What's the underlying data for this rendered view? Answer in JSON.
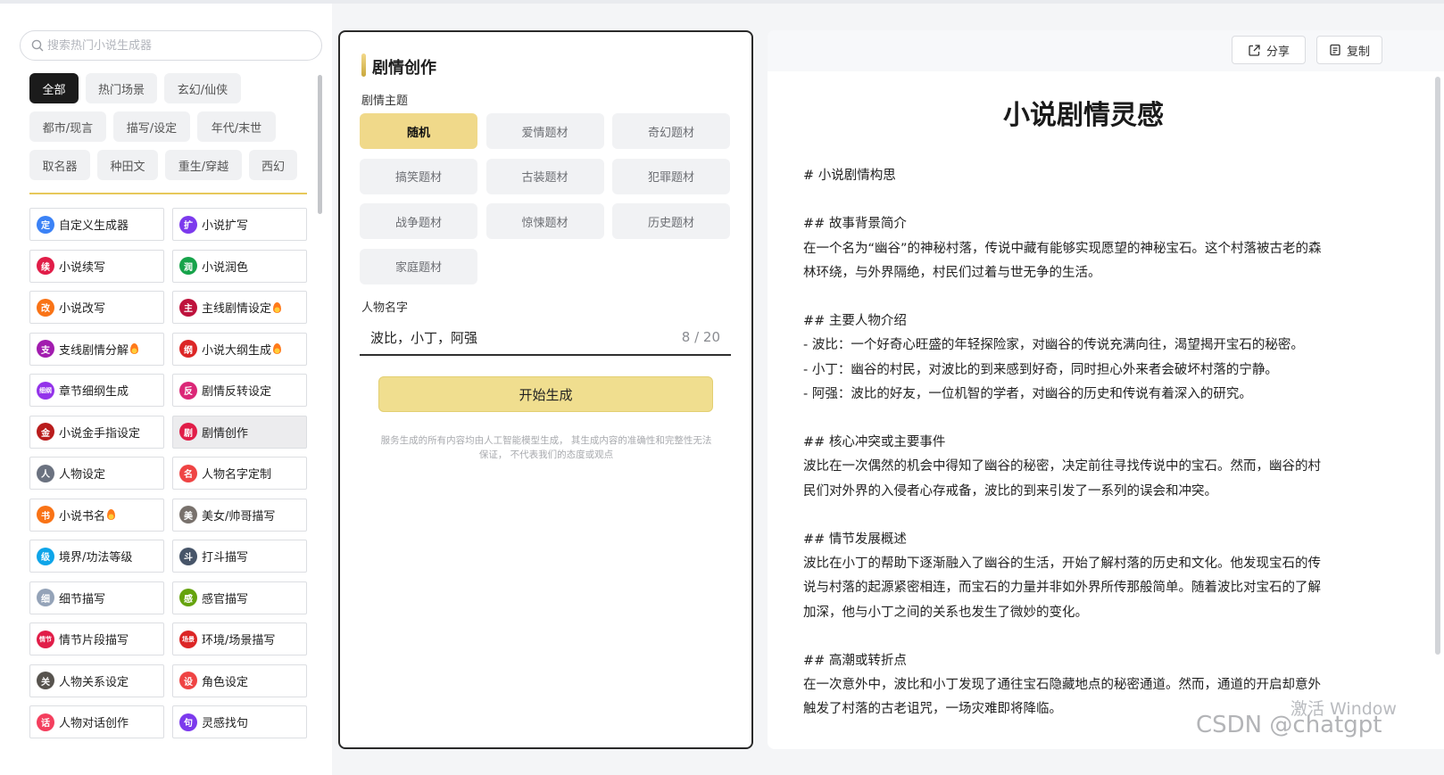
{
  "search": {
    "placeholder": "搜索热门小说生成器"
  },
  "categories": [
    {
      "label": "全部",
      "active": true
    },
    {
      "label": "热门场景"
    },
    {
      "label": "玄幻/仙侠"
    },
    {
      "label": "都市/现言"
    },
    {
      "label": "描写/设定"
    },
    {
      "label": "年代/末世"
    },
    {
      "label": "取名器"
    },
    {
      "label": "种田文"
    },
    {
      "label": "重生/穿越"
    },
    {
      "label": "西幻"
    }
  ],
  "tools": [
    {
      "label": "自定义生成器",
      "icon": "custom-icon",
      "glyph": "定",
      "color": "#3b82f6"
    },
    {
      "label": "小说扩写",
      "icon": "expand-icon",
      "glyph": "扩",
      "color": "#7c3aed"
    },
    {
      "label": "小说续写",
      "icon": "continue-icon",
      "glyph": "续",
      "color": "#e11d48"
    },
    {
      "label": "小说润色",
      "icon": "polish-icon",
      "glyph": "润",
      "color": "#16a34a"
    },
    {
      "label": "小说改写",
      "icon": "rewrite-icon",
      "glyph": "改",
      "color": "#f97316"
    },
    {
      "label": "主线剧情设定",
      "icon": "mainline-icon",
      "glyph": "主",
      "color": "#be123c",
      "hot": true
    },
    {
      "label": "支线剧情分解",
      "icon": "subplot-icon",
      "glyph": "支",
      "color": "#a21caf",
      "hot": true
    },
    {
      "label": "小说大纲生成",
      "icon": "outline-icon",
      "glyph": "纲",
      "color": "#dc2626",
      "hot": true
    },
    {
      "label": "章节细纲生成",
      "icon": "chapter-icon",
      "glyph": "细纲",
      "color": "#9333ea"
    },
    {
      "label": "剧情反转设定",
      "icon": "twist-icon",
      "glyph": "反",
      "color": "#db2777"
    },
    {
      "label": "小说金手指设定",
      "icon": "goldfinger-icon",
      "glyph": "金",
      "color": "#b91c1c"
    },
    {
      "label": "剧情创作",
      "icon": "plot-icon",
      "glyph": "剧",
      "color": "#e11d48",
      "selected": true
    },
    {
      "label": "人物设定",
      "icon": "character-avatar-icon",
      "glyph": "人",
      "color": "#6b7280"
    },
    {
      "label": "人物名字定制",
      "icon": "name-icon",
      "glyph": "名",
      "color": "#ef4444"
    },
    {
      "label": "小说书名",
      "icon": "book-title-icon",
      "glyph": "书",
      "color": "#f97316",
      "hot": true
    },
    {
      "label": "美女/帅哥描写",
      "icon": "portrait-icon",
      "glyph": "美",
      "color": "#78716c"
    },
    {
      "label": "境界/功法等级",
      "icon": "level-icon",
      "glyph": "级",
      "color": "#0ea5e9"
    },
    {
      "label": "打斗描写",
      "icon": "fight-icon",
      "glyph": "斗",
      "color": "#475569"
    },
    {
      "label": "细节描写",
      "icon": "magnifier-icon",
      "glyph": "细",
      "color": "#94a3b8"
    },
    {
      "label": "感官描写",
      "icon": "senses-icon",
      "glyph": "感",
      "color": "#65a30d"
    },
    {
      "label": "情节片段描写",
      "icon": "scene-fragment-icon",
      "glyph": "情节",
      "color": "#e11d48"
    },
    {
      "label": "环境/场景描写",
      "icon": "environment-icon",
      "glyph": "场景",
      "color": "#dc2626"
    },
    {
      "label": "人物关系设定",
      "icon": "relation-icon",
      "glyph": "关",
      "color": "#57534e"
    },
    {
      "label": "角色设定",
      "icon": "role-icon",
      "glyph": "设",
      "color": "#ef4444"
    },
    {
      "label": "人物对话创作",
      "icon": "dialogue-icon",
      "glyph": "话",
      "color": "#f43f5e"
    },
    {
      "label": "灵感找句",
      "icon": "inspiration-icon",
      "glyph": "句",
      "color": "#7c3aed"
    }
  ],
  "form": {
    "title": "剧情创作",
    "theme_label": "剧情主题",
    "themes": [
      {
        "label": "随机",
        "active": true
      },
      {
        "label": "爱情题材"
      },
      {
        "label": "奇幻题材"
      },
      {
        "label": "搞笑题材"
      },
      {
        "label": "古装题材"
      },
      {
        "label": "犯罪题材"
      },
      {
        "label": "战争题材"
      },
      {
        "label": "惊悚题材"
      },
      {
        "label": "历史题材"
      },
      {
        "label": "家庭题材"
      }
    ],
    "name_label": "人物名字",
    "name_value": "波比，小丁，阿强",
    "name_count": "8 / 20",
    "generate_label": "开始生成",
    "disclaimer_line1": "服务生成的所有内容均由人工智能模型生成， 其生成内容的准确性和完整性无法",
    "disclaimer_line2": "保证， 不代表我们的态度或观点"
  },
  "result": {
    "share_label": "分享",
    "copy_label": "复制",
    "title": "小说剧情灵感",
    "lines": [
      "# 小说剧情构思",
      "",
      "## 故事背景简介",
      "在一个名为“幽谷”的神秘村落，传说中藏有能够实现愿望的神秘宝石。这个村落被古老的森",
      "林环绕，与外界隔绝，村民们过着与世无争的生活。",
      "",
      "## 主要人物介绍",
      "- 波比：一个好奇心旺盛的年轻探险家，对幽谷的传说充满向往，渴望揭开宝石的秘密。",
      "- 小丁：幽谷的村民，对波比的到来感到好奇，同时担心外来者会破坏村落的宁静。",
      "- 阿强：波比的好友，一位机智的学者，对幽谷的历史和传说有着深入的研究。",
      "",
      "## 核心冲突或主要事件",
      "波比在一次偶然的机会中得知了幽谷的秘密，决定前往寻找传说中的宝石。然而，幽谷的村",
      "民们对外界的入侵者心存戒备，波比的到来引发了一系列的误会和冲突。",
      "",
      "## 情节发展概述",
      "波比在小丁的帮助下逐渐融入了幽谷的生活，开始了解村落的历史和文化。他发现宝石的传",
      "说与村落的起源紧密相连，而宝石的力量并非如外界所传那般简单。随着波比对宝石的了解",
      "加深，他与小丁之间的关系也发生了微妙的变化。",
      "",
      "## 高潮或转折点",
      "在一次意外中，波比和小丁发现了通往宝石隐藏地点的秘密通道。然而，通道的开启却意外",
      "触发了村落的古老诅咒，一场灾难即将降临。"
    ]
  },
  "watermarks": {
    "activate": "激活 Window",
    "csdn": "CSDN @chatgpt"
  }
}
